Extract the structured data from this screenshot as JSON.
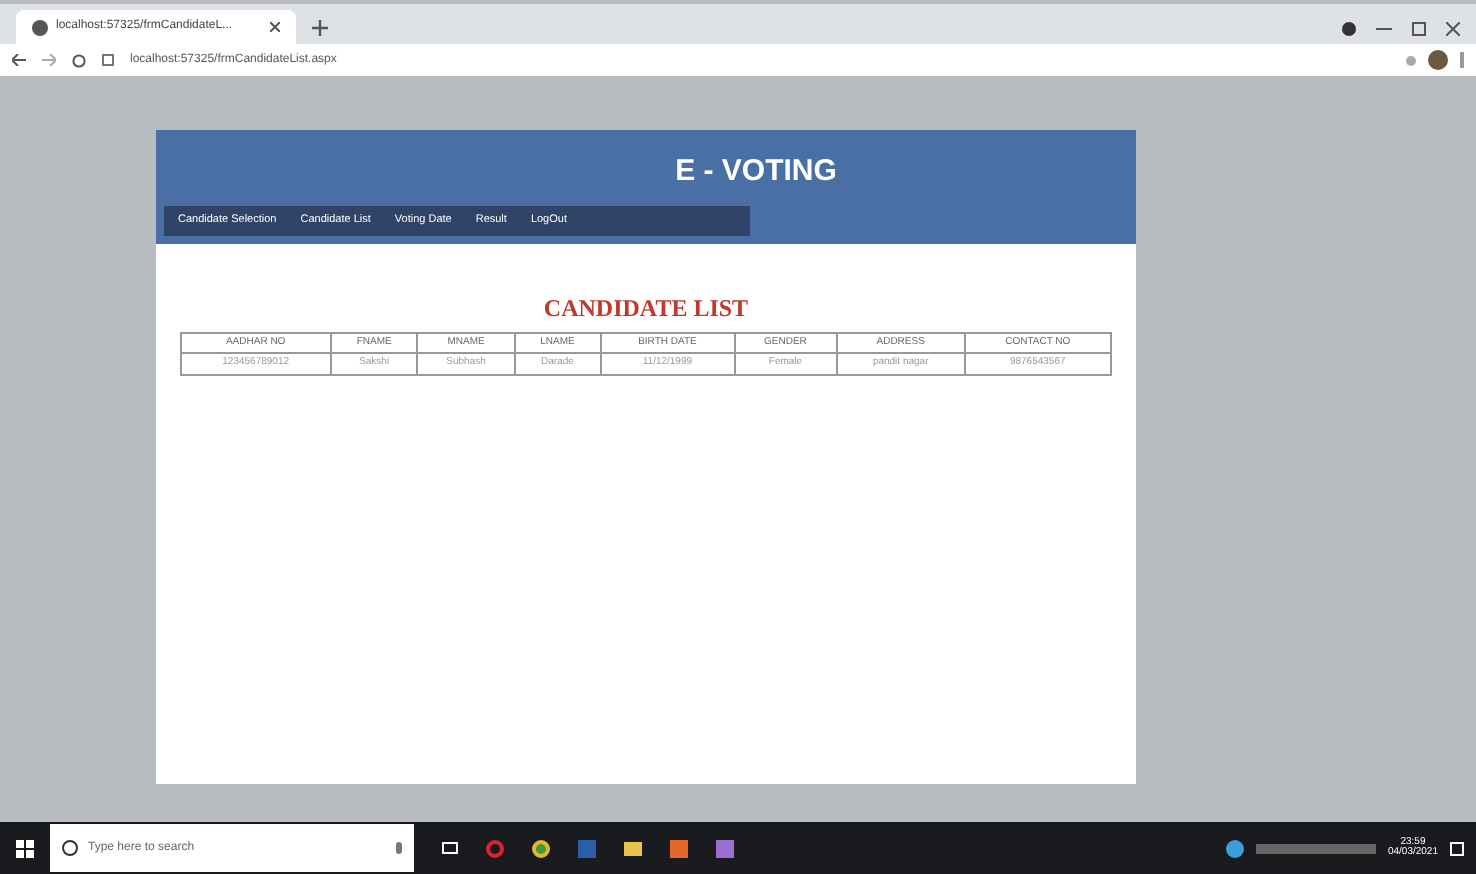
{
  "browser": {
    "tab_title": "localhost:57325/frmCandidateL...",
    "address": "localhost:57325/frmCandidateList.aspx"
  },
  "site": {
    "title": "E - VOTING",
    "nav": [
      {
        "label": "Candidate Selection"
      },
      {
        "label": "Candidate List"
      },
      {
        "label": "Voting Date"
      },
      {
        "label": "Result"
      },
      {
        "label": "LogOut"
      }
    ]
  },
  "list": {
    "heading": "CANDIDATE LIST",
    "columns": [
      "AADHAR NO",
      "FNAME",
      "MNAME",
      "LNAME",
      "BIRTH DATE",
      "GENDER",
      "ADDRESS",
      "CONTACT NO"
    ],
    "rows": [
      [
        "123456789012",
        "Sakshi",
        "Subhash",
        "Darade",
        "11/12/1999",
        "Female",
        "pandit nagar",
        "9876543567"
      ]
    ]
  },
  "taskbar": {
    "search_placeholder": "Type here to search",
    "time": "23:59",
    "date": "04/03/2021"
  }
}
